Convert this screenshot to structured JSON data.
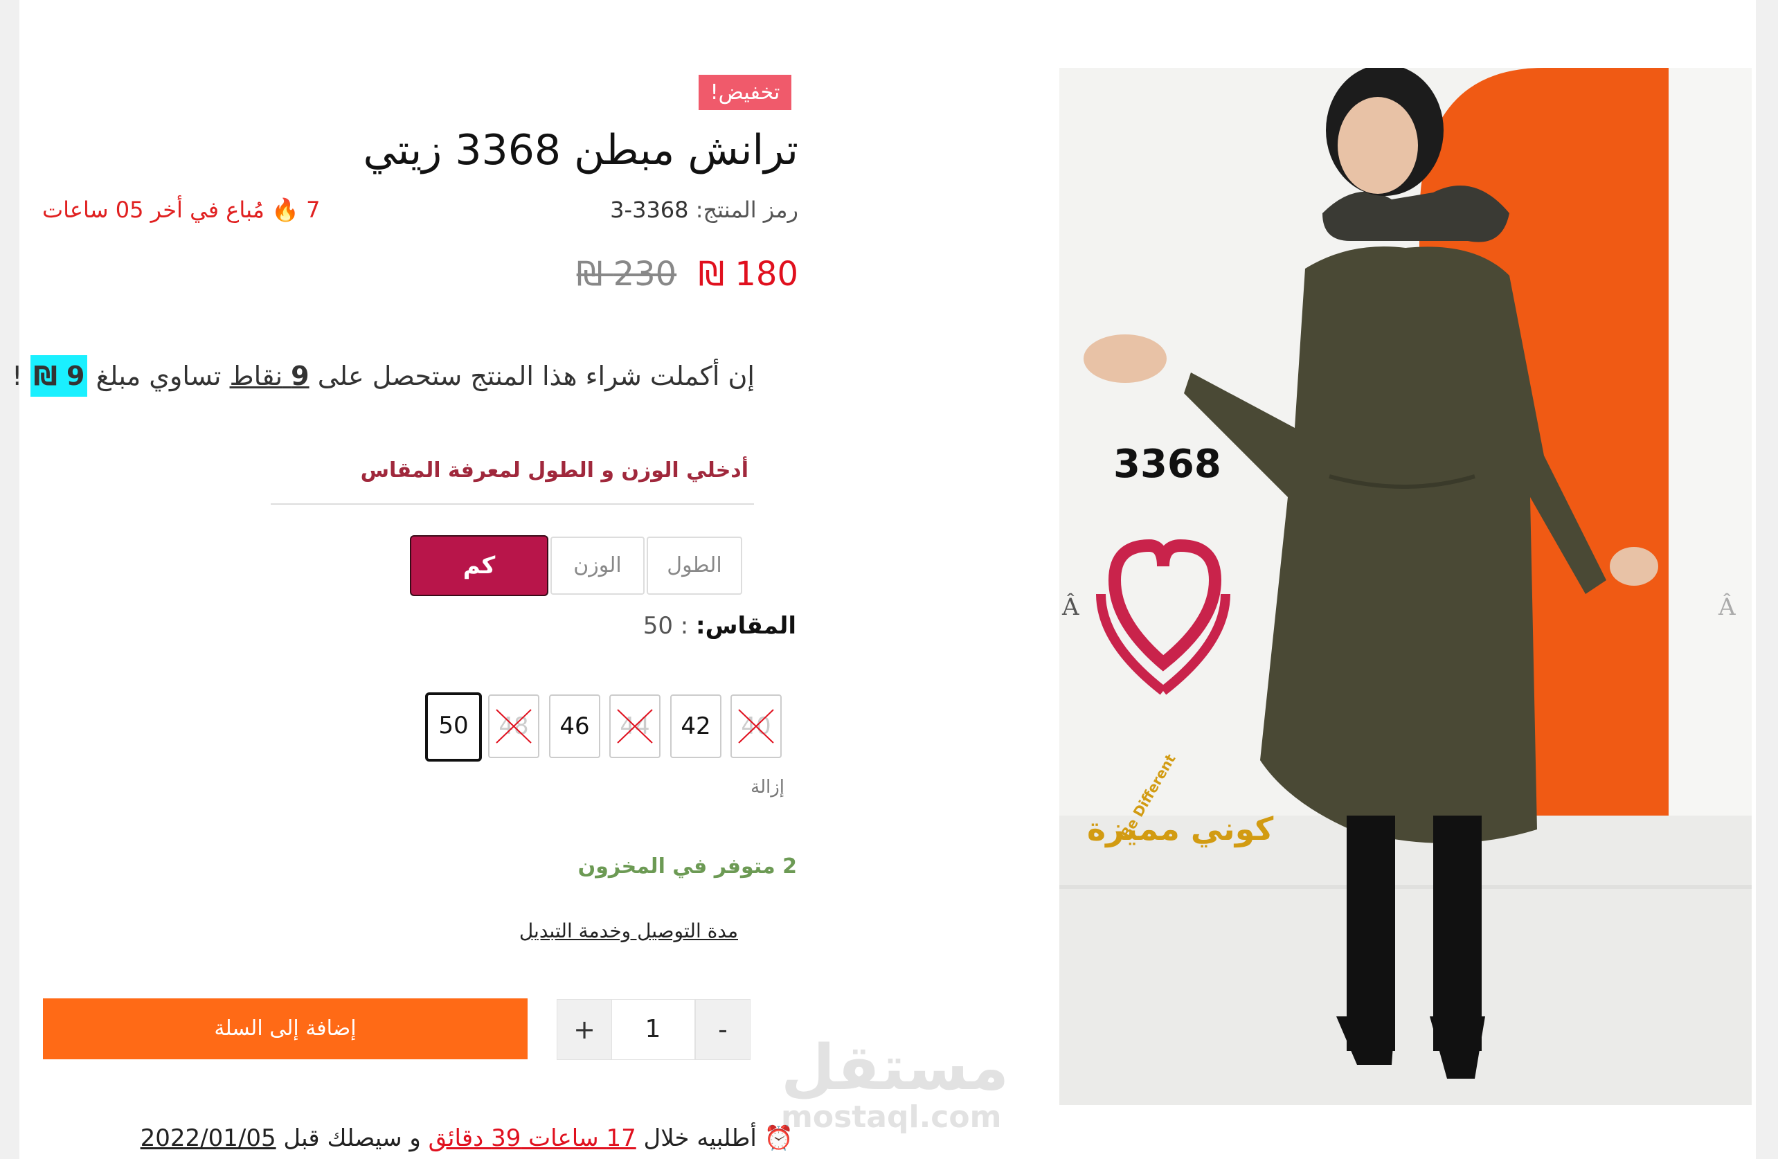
{
  "product": {
    "sale_badge": "تخفيض!",
    "title": "ترانش مبطن 3368 زيتي",
    "sku_label": "رمز المنتج:",
    "sku_value": "3368-3",
    "sold_count": "7",
    "sold_text": "مُباع في أخر 05 ساعات",
    "price_new": "180 ₪",
    "price_old": "230 ₪",
    "image_code": "3368",
    "brand_caption": "كوني مميزة",
    "brand_sub": "Be Different"
  },
  "points": {
    "prefix": "إن أكملت شراء هذا المنتج ستحصل على",
    "points_count": "9",
    "points_word": "نقاط",
    "middle": "تساوي مبلغ",
    "amount": "9 ₪",
    "suffix": "!"
  },
  "size_calculator": {
    "heading": "أدخلي الوزن و الطول لمعرفة المقاس",
    "height_placeholder": "الطول",
    "weight_placeholder": "الوزن",
    "button_label": "كم مقاسي؟"
  },
  "size_selector": {
    "label": "المقاس:",
    "selected_value": ": 50",
    "options": [
      {
        "label": "40",
        "available": false
      },
      {
        "label": "42",
        "available": true
      },
      {
        "label": "44",
        "available": false
      },
      {
        "label": "46",
        "available": true
      },
      {
        "label": "48",
        "available": false
      },
      {
        "label": "50",
        "available": true,
        "selected": true
      }
    ],
    "clear_label": "إزالة"
  },
  "stock_text": "2 متوفر في المخزون",
  "delivery_link": "مدة التوصيل وخدمة التبديل",
  "cart": {
    "minus": "-",
    "plus": "+",
    "quantity": "1",
    "add_to_cart": "إضافة إلى السلة"
  },
  "watermark": {
    "arabic": "مستقل",
    "latin": "mostaql.com"
  },
  "order_timer": {
    "prefix": "⏰ أطلبيه خلال",
    "time_left": "17 ساعات 39 دقائق",
    "middle": "و سيصلك قبل",
    "date": "2022/01/05"
  },
  "colors": {
    "sale_badge": "#f05a6b",
    "price_new": "#e0101e",
    "size_heading": "#a0283c",
    "calc_button": "#b8154a",
    "stock": "#6c9a54",
    "add_to_cart": "#ff6a16",
    "points_highlight": "#1af0ff"
  }
}
